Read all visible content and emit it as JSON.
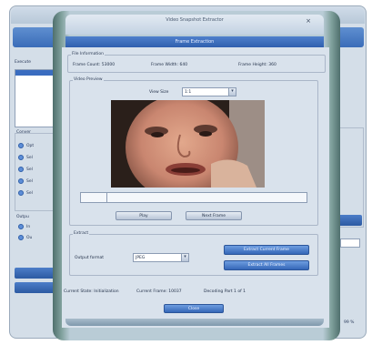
{
  "background_window": {
    "side_labels": [
      "Conver",
      "Opt",
      "Sel",
      "Sel",
      "Sel",
      "Sel",
      "Outpu",
      "In",
      "Ou"
    ],
    "header_label": "Execute",
    "right_label": "99 %"
  },
  "dialog": {
    "title": "Video Snapshot Extractor",
    "band_label": "Frame Extraction",
    "close_glyph": "×"
  },
  "file_information": {
    "legend": "File Information",
    "frame_count": "Frame Count: 53000",
    "frame_width": "Frame Width: 640",
    "frame_height": "Frame Height: 360"
  },
  "video_preview": {
    "legend": "Video Preview",
    "view_size_label": "View Size",
    "view_size_value": "1:1",
    "position_percent": 12,
    "play_label": "Play",
    "next_frame_label": "Next Frame"
  },
  "extract": {
    "legend": "Extract",
    "output_format_label": "Output format",
    "output_format_value": "JPEG",
    "extract_current_label": "Extract Current Frame",
    "extract_all_label": "Extract All Frames"
  },
  "status": {
    "current_state": "Current State: Initialization",
    "current_frame": "Current Frame: 10037",
    "decoding": "Decoding Part 1 of 1"
  },
  "footer": {
    "close_label": "Close"
  },
  "colors": {
    "accent_blue": "#3567b8",
    "frame_teal": "#4f6f6d",
    "panel": "#d9e2ec"
  }
}
